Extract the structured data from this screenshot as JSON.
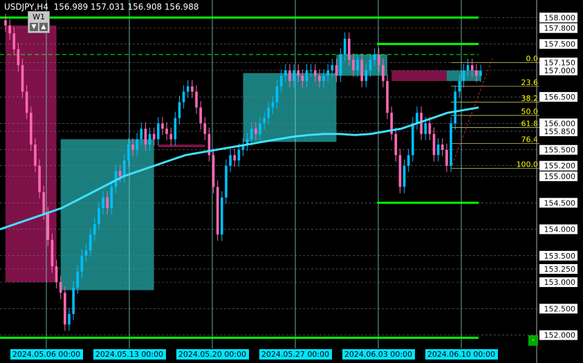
{
  "header": {
    "symbol": "USDJPY,H4",
    "ohlc": "156.989 157.031 156.908 156.988",
    "timeframe_button": "W1"
  },
  "colors": {
    "background": "#000000",
    "bull_candle": "#00BFFF",
    "bear_candle": "#FF69B4",
    "moving_average": "#40E0FF",
    "bull_zone": "#1E8C8C",
    "bear_zone": "#8C1450",
    "level_line": "#00FF00",
    "fib_text": "#FFFF00",
    "grid": "#777777",
    "price_label_bg": "#FFFFFF",
    "date_label_bg": "#00E5FF"
  },
  "chart_data": {
    "type": "candlestick",
    "symbol": "USDJPY",
    "timeframe": "H4",
    "ylim": [
      151.8,
      158.2
    ],
    "price_ticks": [
      "158.000",
      "157.800",
      "157.500",
      "157.150",
      "157.000",
      "156.500",
      "156.000",
      "155.850",
      "155.500",
      "155.200",
      "155.000",
      "154.500",
      "154.000",
      "153.500",
      "153.250",
      "153.000",
      "152.500",
      "152.000"
    ],
    "date_labels": [
      "2024.05.06 00:00",
      "2024.05.13 00:00",
      "2024.05.20 00:00",
      "2024.05.27 00:00",
      "2024.06.03 00:00",
      "2024.06.10 00:00"
    ],
    "horizontal_levels": [
      158.0,
      157.5,
      154.5,
      151.95
    ],
    "dashed_level": 157.3,
    "fibonacci": {
      "high": 157.15,
      "low": 155.15,
      "levels": [
        {
          "label": "0.0",
          "value": 157.15
        },
        {
          "label": "23.6",
          "value": 156.7
        },
        {
          "label": "38.2",
          "value": 156.4
        },
        {
          "label": "50.0",
          "value": 156.15
        },
        {
          "label": "61.8",
          "value": 155.92
        },
        {
          "label": "76.4",
          "value": 155.62
        },
        {
          "label": "100.0",
          "value": 155.15
        }
      ]
    },
    "close_series": [
      157.85,
      157.7,
      157.4,
      157.1,
      156.6,
      156.2,
      155.6,
      155.2,
      154.7,
      154.3,
      153.8,
      153.3,
      153.0,
      152.8,
      152.2,
      152.4,
      152.9,
      153.2,
      153.5,
      153.6,
      153.9,
      154.1,
      154.4,
      154.6,
      154.4,
      154.8,
      155.1,
      155.0,
      155.3,
      155.6,
      155.5,
      155.7,
      155.9,
      155.6,
      155.8,
      155.7,
      156.0,
      155.9,
      155.8,
      155.7,
      156.1,
      156.4,
      156.6,
      156.7,
      156.6,
      156.3,
      156.0,
      155.8,
      155.4,
      154.8,
      153.9,
      154.6,
      155.2,
      155.4,
      155.3,
      155.5,
      155.6,
      155.7,
      155.9,
      155.8,
      156.0,
      156.1,
      156.3,
      156.4,
      156.7,
      156.9,
      157.0,
      156.8,
      157.0,
      156.9,
      156.8,
      157.0,
      157.0,
      156.9,
      156.8,
      156.9,
      157.0,
      157.1,
      156.9,
      157.3,
      157.6,
      157.2,
      157.0,
      157.2,
      156.8,
      157.0,
      157.2,
      157.3,
      157.1,
      156.8,
      156.2,
      155.8,
      155.4,
      154.8,
      155.2,
      155.4,
      156.0,
      156.2,
      155.8,
      156.0,
      155.8,
      155.4,
      155.6,
      155.5,
      155.2,
      156.0,
      156.6,
      156.8,
      157.0,
      157.1,
      157.0,
      156.9,
      156.99
    ],
    "moving_average_series": [
      154.0,
      154.1,
      154.2,
      154.3,
      154.4,
      154.55,
      154.7,
      154.85,
      155.0,
      155.1,
      155.2,
      155.3,
      155.4,
      155.45,
      155.5,
      155.55,
      155.6,
      155.65,
      155.7,
      155.75,
      155.78,
      155.8,
      155.8,
      155.78,
      155.8,
      155.85,
      155.9,
      156.0,
      156.1,
      156.2,
      156.25,
      156.3
    ],
    "zones": [
      {
        "type": "bear",
        "from_index": 0,
        "to_index": 12,
        "top": 157.85,
        "bottom": 153.0
      },
      {
        "type": "bull",
        "from_index": 13,
        "to_index": 35,
        "top": 155.7,
        "bottom": 152.85
      },
      {
        "type": "bear",
        "from_index": 36,
        "to_index": 47,
        "top": 155.6,
        "bottom": 155.55
      },
      {
        "type": "bull",
        "from_index": 56,
        "to_index": 78,
        "top": 156.95,
        "bottom": 155.65
      },
      {
        "type": "bull",
        "from_index": 78,
        "to_index": 90,
        "top": 157.3,
        "bottom": 156.9
      },
      {
        "type": "bear",
        "from_index": 91,
        "to_index": 104,
        "top": 157.0,
        "bottom": 156.8
      },
      {
        "type": "bull",
        "from_index": 104,
        "to_index": 112,
        "top": 157.0,
        "bottom": 156.8
      }
    ]
  }
}
